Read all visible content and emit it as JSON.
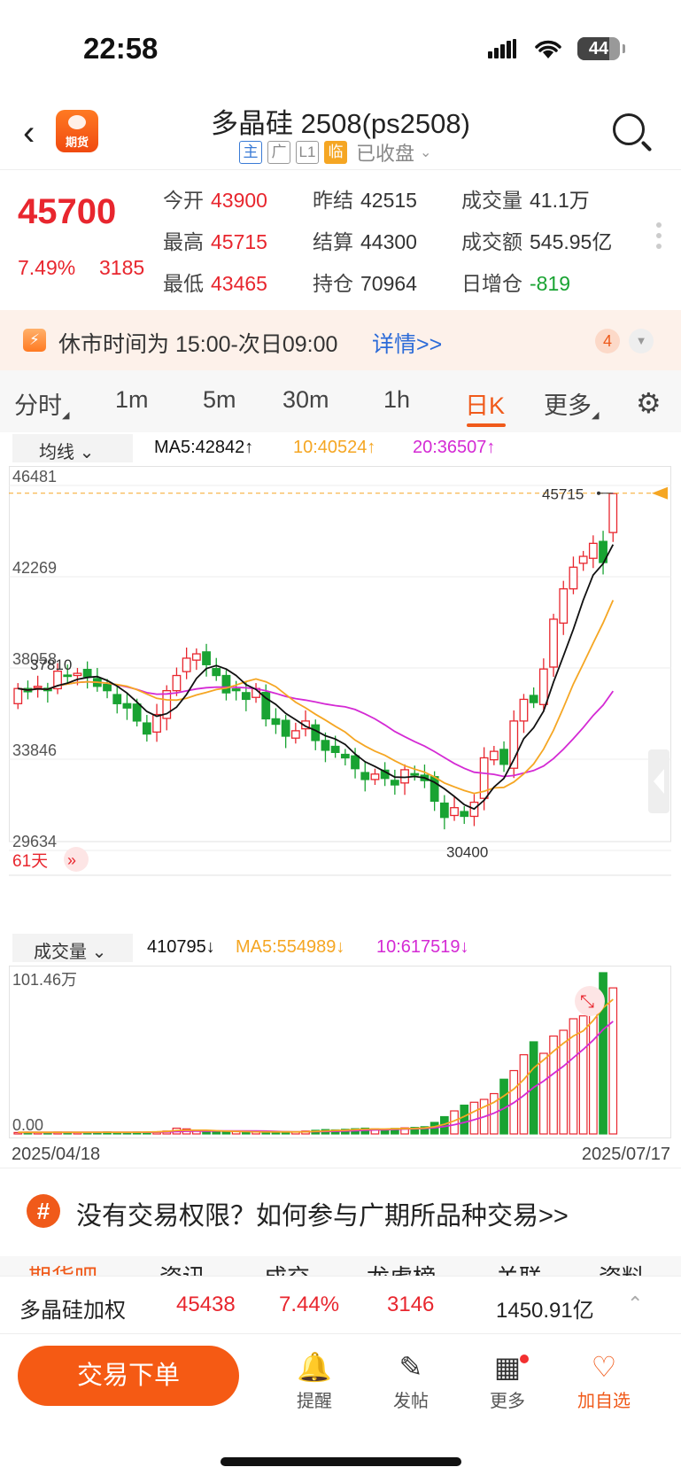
{
  "status": {
    "time": "22:58",
    "battery": "44"
  },
  "header": {
    "logo_text": "期货",
    "title": "多晶硅 2508(ps2508)",
    "tags": [
      "主",
      "广",
      "L1",
      "临"
    ],
    "market_status": "已收盘"
  },
  "quote": {
    "last": "45700",
    "change_pct": "7.49%",
    "change": "3185",
    "fields": [
      {
        "label": "今开",
        "value": "43900",
        "tone": "red"
      },
      {
        "label": "昨结",
        "value": "42515",
        "tone": "plain"
      },
      {
        "label": "成交量",
        "value": "41.1万",
        "tone": "plain"
      },
      {
        "label": "最高",
        "value": "45715",
        "tone": "red"
      },
      {
        "label": "结算",
        "value": "44300",
        "tone": "plain"
      },
      {
        "label": "成交额",
        "value": "545.95亿",
        "tone": "plain"
      },
      {
        "label": "最低",
        "value": "43465",
        "tone": "red"
      },
      {
        "label": "持仓",
        "value": "70964",
        "tone": "plain"
      },
      {
        "label": "日增仓",
        "value": "-819",
        "tone": "green"
      }
    ]
  },
  "notice": {
    "text": "休市时间为 15:00-次日09:00",
    "link": "详情>>",
    "badge": "4"
  },
  "tabs": [
    "分时",
    "1m",
    "5m",
    "30m",
    "1h",
    "日K",
    "更多"
  ],
  "ma": {
    "selector": "均线",
    "ma5": "MA5:42842↑",
    "ma10": "10:40524↑",
    "ma20": "20:36507↑"
  },
  "volume_row": {
    "selector": "成交量",
    "vol": "410795↓",
    "ma5": "MA5:554989↓",
    "ma10": "10:617519↓"
  },
  "colors": {
    "up": "#e8262e",
    "down": "#19a332",
    "ma5": "#111111",
    "ma10": "#f5a623",
    "ma20": "#d42ad4",
    "accent": "#f05a1a"
  },
  "chart_data": [
    {
      "type": "candlestick",
      "y_ticks": [
        "46481",
        "42269",
        "38058",
        "33846",
        "29634"
      ],
      "ylim": [
        29634,
        46481
      ],
      "annotations": {
        "high": "45715",
        "low": "30400",
        "left_marker": "37810"
      },
      "period_label": "61天",
      "date_start": "2025/04/18",
      "date_end": "2025/07/17",
      "close": [
        36700,
        36550,
        36800,
        36600,
        37500,
        37300,
        37400,
        37250,
        36800,
        36600,
        36000,
        35800,
        35200,
        34600,
        35500,
        36600,
        37300,
        38100,
        38300,
        37800,
        37300,
        36500,
        36600,
        36200,
        36700,
        35300,
        35050,
        34500,
        34750,
        35200,
        34300,
        33850,
        33750,
        33500,
        33000,
        32500,
        32750,
        32550,
        32250,
        32950,
        32700,
        32450,
        31500,
        30750,
        31200,
        30800,
        31450,
        33500,
        33800,
        33200,
        35200,
        36200,
        36050,
        37600,
        39900,
        41300,
        42300,
        42800,
        43400,
        42515,
        45700
      ],
      "ma5": "computed",
      "ma10": "computed",
      "ma20": "computed"
    },
    {
      "type": "bar",
      "name": "成交量",
      "ylabel_max": "101.46万",
      "ylabel_min": "0.00",
      "ylim": [
        0,
        101.46
      ],
      "values": [
        1.0,
        1.2,
        1.1,
        0.9,
        1.3,
        1.2,
        1.0,
        1.1,
        1.2,
        1.4,
        1.0,
        1.1,
        1.3,
        1.2,
        1.5,
        2.0,
        4.0,
        3.5,
        2.2,
        1.8,
        1.5,
        1.3,
        1.6,
        1.4,
        1.5,
        1.2,
        1.3,
        1.6,
        1.4,
        2.0,
        2.5,
        3.0,
        2.8,
        3.2,
        3.6,
        4.0,
        3.5,
        3.0,
        3.8,
        4.2,
        4.5,
        5.0,
        8.0,
        12.0,
        16.0,
        20.0,
        22.0,
        24.0,
        28.0,
        38.0,
        44.0,
        55.0,
        64.0,
        56.0,
        68.0,
        72.0,
        80.0,
        82.0,
        92.0,
        112.0,
        101.46
      ],
      "ma5": [
        1.1,
        1.1,
        1.1,
        1.1,
        1.1,
        1.1,
        1.1,
        1.1,
        1.2,
        1.2,
        1.1,
        1.2,
        1.2,
        1.3,
        1.4,
        1.7,
        2.4,
        2.6,
        2.6,
        2.6,
        2.2,
        1.9,
        1.7,
        1.6,
        1.5,
        1.4,
        1.4,
        1.4,
        1.4,
        1.5,
        1.8,
        2.1,
        2.4,
        2.6,
        3.0,
        3.3,
        3.4,
        3.4,
        3.6,
        3.7,
        3.8,
        4.1,
        5.0,
        6.7,
        9.1,
        12.2,
        15.6,
        18.8,
        22.0,
        26.4,
        31.2,
        37.8,
        45.8,
        51.4,
        57.4,
        63.0,
        68.0,
        71.6,
        78.8,
        87.6,
        93.5
      ]
    }
  ],
  "promo": {
    "icon": "#",
    "text": "没有交易权限？如何参与广期所品种交易>>"
  },
  "peek_tabs": [
    "期货吧",
    "资讯",
    "成交",
    "龙虎榜",
    "关联",
    "资料"
  ],
  "weighted": {
    "name": "多晶硅加权",
    "price": "45438",
    "pct": "7.44%",
    "change": "3146",
    "amount": "1450.91亿"
  },
  "bottom": {
    "order": "交易下单",
    "items": [
      "提醒",
      "发帖",
      "更多",
      "加自选"
    ]
  }
}
